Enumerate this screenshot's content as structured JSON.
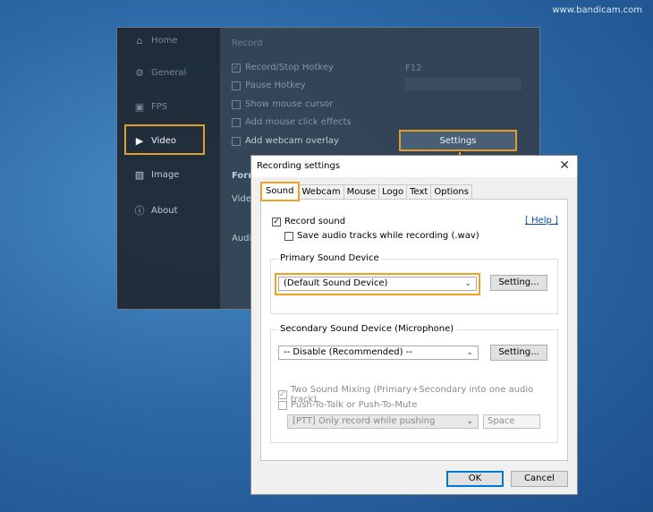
{
  "watermark": "www.bandicam.com",
  "background_window": {
    "sidebar": [
      {
        "label": "Home",
        "icon": "home-icon"
      },
      {
        "label": "General",
        "icon": "gear-icon"
      },
      {
        "label": "FPS",
        "icon": "fps-icon"
      },
      {
        "label": "Video",
        "icon": "video-icon"
      },
      {
        "label": "Image",
        "icon": "image-icon"
      },
      {
        "label": "About",
        "icon": "info-icon"
      }
    ],
    "section_title": "Record",
    "options": [
      {
        "label": "Record/Stop Hotkey",
        "checked": true
      },
      {
        "label": "Pause Hotkey",
        "checked": false
      },
      {
        "label": "Show mouse cursor",
        "checked": false
      },
      {
        "label": "Add mouse click effects",
        "checked": false
      },
      {
        "label": "Add webcam overlay",
        "checked": false
      }
    ],
    "hotkey_value": "F12",
    "settings_button": "Settings",
    "format_label": "Form",
    "video_label": "Vide",
    "audio_label": "Audi"
  },
  "dialog": {
    "title": "Recording settings",
    "close_glyph": "✕",
    "tabs": [
      "Sound",
      "Webcam",
      "Mouse",
      "Logo",
      "Text",
      "Options"
    ],
    "active_tab": "Sound",
    "record_sound_label": "Record sound",
    "record_sound_checked": true,
    "save_tracks_label": "Save audio tracks while recording (.wav)",
    "help_link": "[ Help ]",
    "primary": {
      "label": "Primary Sound Device",
      "selected": "(Default Sound Device)",
      "setting_button": "Setting..."
    },
    "secondary": {
      "label": "Secondary Sound Device (Microphone)",
      "selected": "-- Disable (Recommended) --",
      "setting_button": "Setting...",
      "two_sound_mixing_label": "Two Sound Mixing (Primary+Secondary into one audio track)",
      "push_to_talk_label": "Push-To-Talk or Push-To-Mute",
      "ptt_mode_selected": "[PTT] Only record while pushing",
      "ptt_key": "Space"
    },
    "ok_button": "OK",
    "cancel_button": "Cancel"
  },
  "colors": {
    "highlight": "#f2a11d",
    "link": "#0645ad",
    "primary_button_border": "#0078d7"
  }
}
